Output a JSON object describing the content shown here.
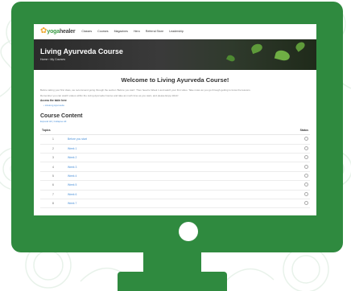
{
  "colors": {
    "frame": "#2f8a3f",
    "accent": "#4a90d9",
    "background": "#ffffff"
  },
  "site": {
    "logo": {
      "part1": "yoga",
      "part2": "healer"
    },
    "nav": [
      "Classes",
      "Courses",
      "Magazines",
      "Hero",
      "Referral Store",
      "Leadership"
    ]
  },
  "hero": {
    "title": "Living Ayurveda Course",
    "breadcrumb": "Home › My Courses"
  },
  "main": {
    "welcome": "Welcome to Living Ayurveda Course!",
    "paragraph1": "Before taking your first class, we recommend going through the section 'Before you start'. Then head to Week 1 and watch your first video. Take notes as you go through getting to know the lessons.",
    "paragraph2": "Remember you can watch videos within the Living Ayurveda Course and take as much time as you want, and please Enjoy Work!",
    "access_label": "Access the table here",
    "access_link": "Lifelong Ayurveda",
    "course_content_title": "Course Content",
    "toggle": "Expand All | Collapse All",
    "columns": {
      "topics": "Topics",
      "status": "Status"
    },
    "rows": [
      {
        "num": "1",
        "topic": "Before you start",
        "status_icon": "status-circle-icon"
      },
      {
        "num": "2",
        "topic": "Week 1",
        "status_icon": "status-circle-icon"
      },
      {
        "num": "3",
        "topic": "Week 2",
        "status_icon": "status-circle-icon"
      },
      {
        "num": "4",
        "topic": "Week 3",
        "status_icon": "status-circle-icon"
      },
      {
        "num": "5",
        "topic": "Week 4",
        "status_icon": "status-circle-icon"
      },
      {
        "num": "6",
        "topic": "Week 5",
        "status_icon": "status-circle-icon"
      },
      {
        "num": "7",
        "topic": "Week 6",
        "status_icon": "status-circle-icon"
      },
      {
        "num": "8",
        "topic": "Week 7",
        "status_icon": "status-circle-icon"
      }
    ]
  }
}
